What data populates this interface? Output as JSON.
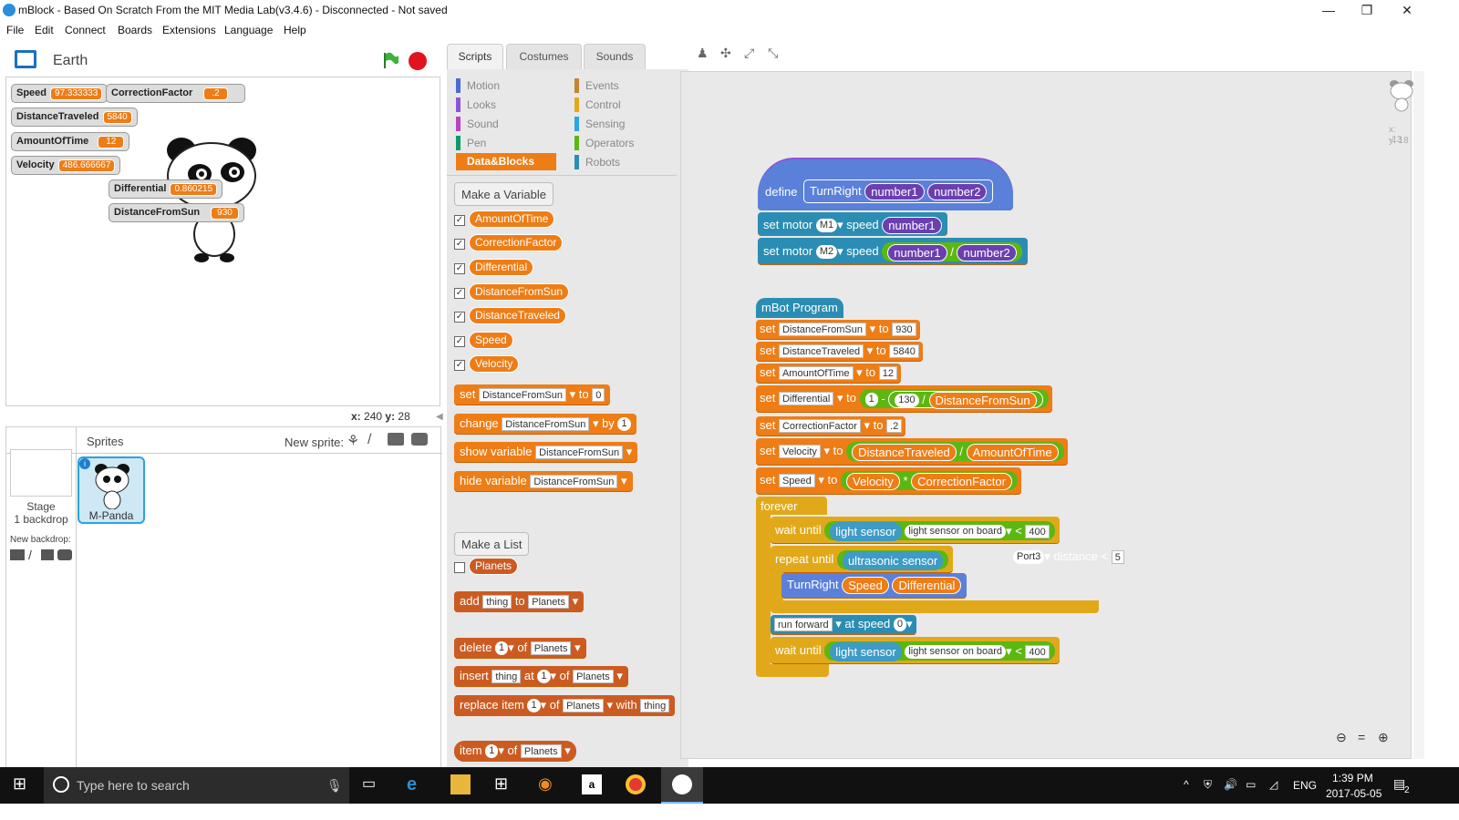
{
  "window": {
    "title": "mBlock - Based On Scratch From the MIT Media Lab(v3.4.6) - Disconnected - Not saved",
    "min": "—",
    "max": "❐",
    "close": "✕"
  },
  "menu": [
    "File",
    "Edit",
    "Connect",
    "Boards",
    "Extensions",
    "Language",
    "Help"
  ],
  "stage": {
    "sprite_name": "Earth",
    "coords_x_label": "x:",
    "coords_x": "240",
    "coords_y_label": "y:",
    "coords_y": "28"
  },
  "monitors": [
    {
      "name": "Speed",
      "value": "97.333333"
    },
    {
      "name": "CorrectionFactor",
      "value": ".2"
    },
    {
      "name": "DistanceTraveled",
      "value": "5840"
    },
    {
      "name": "AmountOfTime",
      "value": "12"
    },
    {
      "name": "Velocity",
      "value": "486.666667"
    },
    {
      "name": "Differential",
      "value": "0.860215"
    },
    {
      "name": "DistanceFromSun",
      "value": "930"
    }
  ],
  "sprites": {
    "header": "Sprites",
    "new_sprite": "New sprite:",
    "stage_label": "Stage",
    "stage_sub": "1 backdrop",
    "new_backdrop": "New backdrop:",
    "sprite1": "M-Panda"
  },
  "tabs": [
    "Scripts",
    "Costumes",
    "Sounds"
  ],
  "categories_left": [
    {
      "name": "Motion",
      "color": "#4a6cd4"
    },
    {
      "name": "Looks",
      "color": "#8a55d7"
    },
    {
      "name": "Sound",
      "color": "#bb42c3"
    },
    {
      "name": "Pen",
      "color": "#0e9a6c"
    },
    {
      "name": "Data&Blocks",
      "color": "#ee7d16"
    }
  ],
  "categories_right": [
    {
      "name": "Events",
      "color": "#c88330"
    },
    {
      "name": "Control",
      "color": "#e1a91a"
    },
    {
      "name": "Sensing",
      "color": "#2ca5e2"
    },
    {
      "name": "Operators",
      "color": "#5cb712"
    },
    {
      "name": "Robots",
      "color": "#2b8db3"
    }
  ],
  "palette": {
    "make_variable": "Make a Variable",
    "variables": [
      "AmountOfTime",
      "CorrectionFactor",
      "Differential",
      "DistanceFromSun",
      "DistanceTraveled",
      "Speed",
      "Velocity"
    ],
    "set": "set",
    "to": "to",
    "change": "change",
    "by": "by",
    "show_variable": "show variable",
    "hide_variable": "hide variable",
    "var_dd": "DistanceFromSun",
    "zero": "0",
    "one": "1",
    "make_list": "Make a List",
    "list": "Planets",
    "add": "add",
    "thing": "thing",
    "delete": "delete",
    "of": "of",
    "insert": "insert",
    "at": "at",
    "replace_item": "replace item",
    "with": "with",
    "item": "item"
  },
  "script": {
    "define": "define",
    "proc": "TurnRight",
    "p1": "number1",
    "p2": "number2",
    "set_motor": "set motor",
    "m1": "M1",
    "m2": "M2",
    "speed": "speed",
    "slash": "/",
    "hat": "mBot Program",
    "set_rows": [
      {
        "var": "DistanceFromSun",
        "val": "930"
      },
      {
        "var": "DistanceTraveled",
        "val": "5840"
      },
      {
        "var": "AmountOfTime",
        "val": "12"
      }
    ],
    "diff_var": "Differential",
    "one": "1",
    "minus": "-",
    "n130": "130",
    "dfs": "DistanceFromSun",
    "cf_var": "CorrectionFactor",
    "cf_val": ".2",
    "vel_var": "Velocity",
    "dt": "DistanceTraveled",
    "aot": "AmountOfTime",
    "spd_var": "Speed",
    "vel": "Velocity",
    "mul": "*",
    "cf": "CorrectionFactor",
    "forever": "forever",
    "wait_until": "wait until",
    "light_sensor": "light sensor",
    "on_board": "light sensor on board",
    "lt": "<",
    "v400": "400",
    "repeat_until": "repeat until",
    "ultrasonic": "ultrasonic sensor",
    "port3": "Port3",
    "distance": "distance",
    "v5": "5",
    "turn": "TurnRight",
    "sp": "Speed",
    "df": "Differential",
    "run_forward": "run forward",
    "at_speed": "at speed",
    "zero": "0"
  },
  "sprite_info": {
    "x": "x: -13",
    "y": "y: 18"
  },
  "taskbar": {
    "search": "Type here to search",
    "lang": "ENG",
    "time": "1:39 PM",
    "date": "2017-05-05",
    "notif": "2"
  }
}
